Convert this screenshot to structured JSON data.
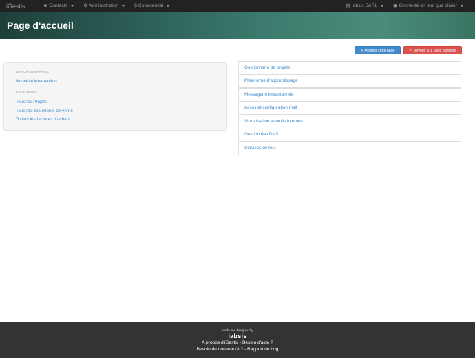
{
  "navbar": {
    "brand": "iGestis",
    "items": [
      {
        "icon": "user-icon",
        "glyph": "☻",
        "label": "Contacts"
      },
      {
        "icon": "gear-icon",
        "glyph": "⚙",
        "label": "Administration"
      },
      {
        "icon": "dollar-icon",
        "glyph": "$",
        "label": "Commercial"
      }
    ],
    "right": [
      {
        "icon": "building-icon",
        "glyph": "▤",
        "label": "Iabsis SARL"
      },
      {
        "icon": "lock-icon",
        "glyph": "▣",
        "label": "Connecté en tant que olivier"
      }
    ]
  },
  "banner": {
    "title": "Page d'accueil"
  },
  "actions": {
    "edit_label": "Modifier cette page",
    "edit_icon": "edit-icon",
    "restore_label": "Revenir à la page d'origine",
    "restore_icon": "undo-icon"
  },
  "left_panel": {
    "quick_nav_header": "NAVIGATION RAPIDE",
    "quick_links": [
      "Nouvelle intervention"
    ],
    "nav_header": "NAVIGATION",
    "nav_links": [
      "Tous les Projets",
      "Tous les documents de vente",
      "Toutes les factures d'achats"
    ]
  },
  "right_panel": {
    "items": [
      "Gestionnaire de projets",
      "Plateforme d'apprentissage",
      "Messagerie instantannée",
      "Accès et configuration mail",
      "Virtualisation et outils internes",
      "Gestion des DNS",
      "Services de test"
    ]
  },
  "footer": {
    "made_by": "Made and designed by",
    "logo": "iabsis",
    "line1": [
      "A propos d'iGestis",
      "Besoin d'aide ?"
    ],
    "line2": [
      "Besoin de nouveauté ?",
      "Rapport de bug"
    ],
    "separator": "-"
  },
  "colors": {
    "navbar": "#222222",
    "link": "#428bca",
    "primary": "#428bca",
    "danger": "#d9534f",
    "footer": "#333333"
  }
}
